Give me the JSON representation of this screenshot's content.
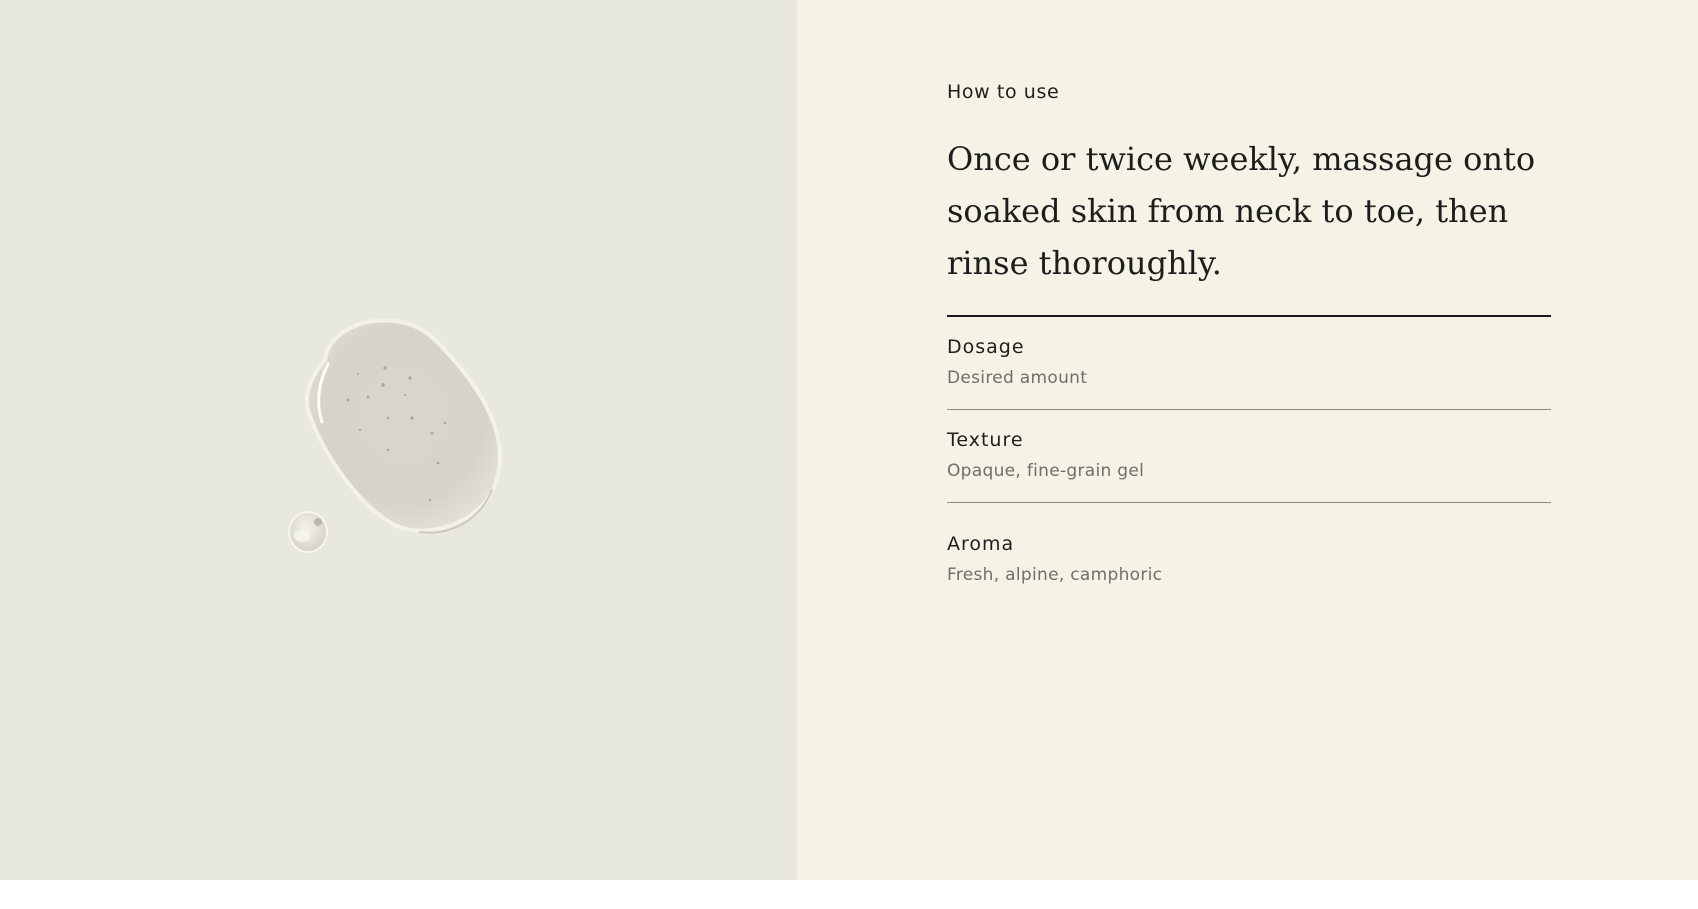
{
  "colors": {
    "left_bg": "#e9e8dc",
    "right_bg": "#f4f3e5",
    "text_primary": "#1d1d1d",
    "text_secondary": "#6f6f69",
    "divider": "#8a8a84"
  },
  "image": {
    "icon": "gel-swatch-image"
  },
  "usage": {
    "eyebrow": "How to use",
    "instructions": "Once or twice weekly, massage onto soaked skin from neck to toe, then rinse thoroughly."
  },
  "specs": [
    {
      "label": "Dosage",
      "value": "Desired amount"
    },
    {
      "label": "Texture",
      "value": "Opaque, fine-grain gel"
    },
    {
      "label": "Aroma",
      "value": "Fresh, alpine, camphoric"
    }
  ]
}
